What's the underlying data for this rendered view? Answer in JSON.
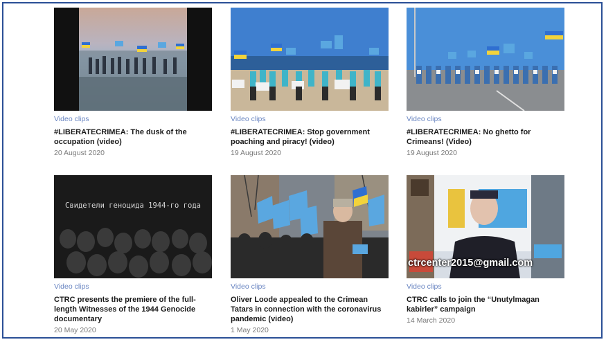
{
  "cards": [
    {
      "category": "Video clips",
      "title": "#LIBERATECRIMEA: The dusk of the occupation (video)",
      "date": "20 August 2020",
      "image": "beach-sunset-flags-photo"
    },
    {
      "category": "Video clips",
      "title": "#LIBERATECRIMEA: Stop government poaching and piracy! (video)",
      "date": "19 August 2020",
      "image": "beach-protest-flags-photo"
    },
    {
      "category": "Video clips",
      "title": "#LIBERATECRIMEA: No ghetto for Crimeans! (Video)",
      "date": "19 August 2020",
      "image": "roadside-protest-flags-photo"
    },
    {
      "category": "Video clips",
      "title": "CTRC presents the premiere of the full-length Witnesses of the 1944 Genocide documentary",
      "date": "20 May 2020",
      "image": "documentary-faces-photo",
      "overlay_text": "Свидетели геноцида 1944-го года"
    },
    {
      "category": "Video clips",
      "title": "Oliver Loode appealed to the Crimean Tatars in connection with the coronavirus pandemic (video)",
      "date": "1 May 2020",
      "image": "march-with-flags-photo"
    },
    {
      "category": "Video clips",
      "title": "CTRC calls to join the “Unutylmagan kabirler” campaign",
      "date": "14 March 2020",
      "image": "woman-speaker-photo",
      "overlay_text": "ctrcenter2015@gmail.com"
    }
  ],
  "colors": {
    "border": "#2a4f96",
    "category": "#6a86c2",
    "title": "#1a1a1a",
    "date": "#7a7a7a"
  }
}
